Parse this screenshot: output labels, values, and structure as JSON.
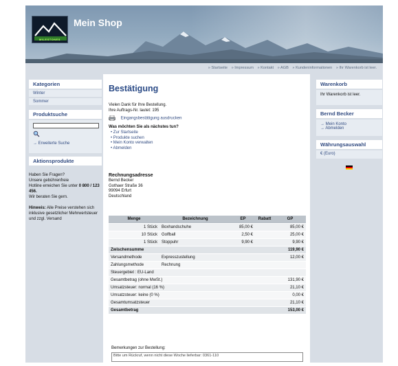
{
  "header": {
    "logo_text": "MILESTONES",
    "shop_title": "Mein Shop"
  },
  "nav": {
    "items": [
      "» Startseite",
      "» Impressum",
      "» Kontakt",
      "» AGB",
      "» Kundeninformationen",
      "» Ihr Warenkorb ist leer."
    ]
  },
  "sidebar_left": {
    "categories_title": "Kategorien",
    "categories": [
      "Winter",
      "Sommer"
    ],
    "search_title": "Produktsuche",
    "search_value": "",
    "advanced_search": "→ Erweiterte Suche",
    "promo_title": "Aktionsprodukte",
    "help_line1": "Haben Sie Fragen?",
    "help_line2": "Unsere gebührenfreie",
    "help_line3": "Hotline erreichen Sie unter",
    "help_phone": "0 800 / 123 456.",
    "help_line4": "Wir beraten Sie gern.",
    "note_label": "Hinweis:",
    "note_text": " Alle Preise verstehen sich inklusive gesetzlicher Mehrwertsteuer und zzgl. Versand"
  },
  "content": {
    "title": "Bestätigung",
    "thanks": "Vielen Dank für Ihre Bestellung.",
    "order_no": "Ihre Auftrags-Nr. lautet: 195",
    "print_link": "Eingangsbestätigung ausdrucken",
    "next_title": "Was möchten Sie als nächstes tun?",
    "next_links": [
      "Zur Startseite",
      "Produkte suchen",
      "Mein Konto verwalten",
      "Abmelden"
    ],
    "address_title": "Rechnungsadresse",
    "address_lines": [
      "Bernd Becker",
      "Gothaer Straße 36",
      "99094 Erfurt",
      "Deutschland"
    ],
    "table_headers": [
      "Menge",
      "Bezeichnung",
      "EP",
      "Rabatt",
      "GP"
    ],
    "items": [
      {
        "qty": "1 Stück",
        "name": "Boxhandschuhe",
        "ep": "85,00 €",
        "rabatt": "",
        "gp": "85,00 €"
      },
      {
        "qty": "10 Stück",
        "name": "Golfball",
        "ep": "2,50 €",
        "rabatt": "",
        "gp": "25,00 €"
      },
      {
        "qty": "1 Stück",
        "name": "Stoppuhr",
        "ep": "9,90 €",
        "rabatt": "",
        "gp": "9,90 €"
      }
    ],
    "subtotal_label": "Zwischensumme",
    "subtotal_value": "119,90 €",
    "shipping_label": "Versandmethode",
    "shipping_value": "Expresszustellung",
    "shipping_cost": "12,00 €",
    "payment_label": "Zahlungsmethode",
    "payment_value": "Rechnung",
    "tax_region": "Steuergebiet : EU-Land",
    "summary": [
      {
        "label": "Gesamtbetrag (ohne MwSt.)",
        "value": "131,90 €"
      },
      {
        "label": "Umsatzsteuer: normal (16 %)",
        "value": "21,10 €"
      },
      {
        "label": "Umsatzsteuer: keine (0 %)",
        "value": "0,00 €"
      },
      {
        "label": "Gesamtumsatzsteuer",
        "value": "21,10 €"
      }
    ],
    "total_label": "Gesamtbetrag",
    "total_value": "153,00 €",
    "remarks_label": "Bemerkungen zur Bestellung:",
    "remarks_value": "Bitte um Rückruf, wenn nicht diese Woche lieferbar: 0361-110"
  },
  "sidebar_right": {
    "cart_title": "Warenkorb",
    "cart_text": "Ihr Warenkorb ist leer.",
    "user_title": "Bernd Becker",
    "user_links": [
      "→ Mein Konto",
      "→ Abmelden"
    ],
    "currency_title": "Währungsauswahl",
    "currency_value": "€ (Euro)"
  },
  "colors": {
    "accent": "#2a4a86",
    "panel": "#e7ecf2",
    "frame": "#d7dde5"
  }
}
